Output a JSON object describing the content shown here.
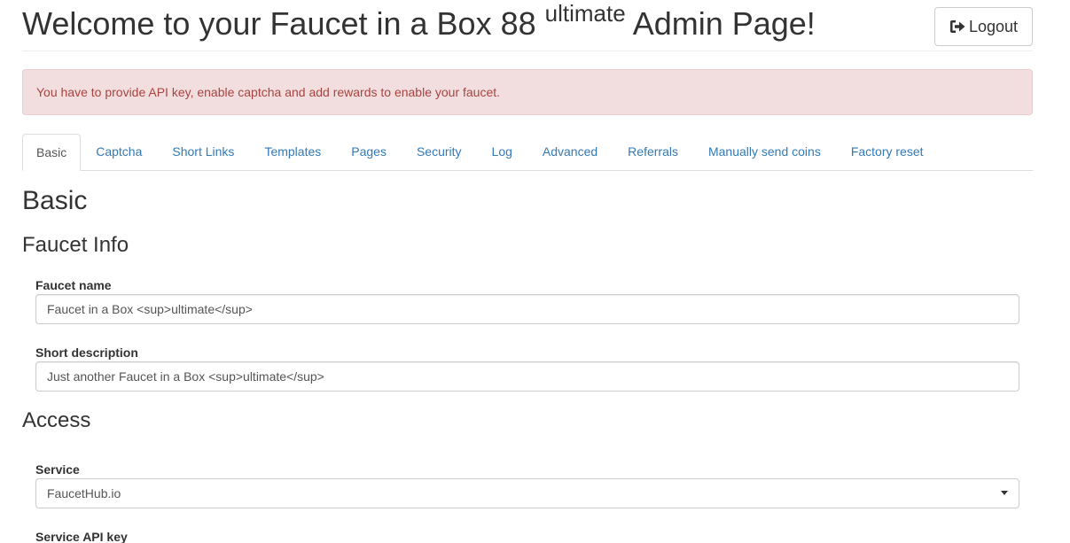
{
  "header": {
    "title_before": "Welcome to your Faucet in a Box 88 ",
    "title_sup": "ultimate",
    "title_after": " Admin Page!",
    "logout_label": "Logout"
  },
  "alert": {
    "text": "You have to provide API key, enable captcha and add rewards to enable your faucet."
  },
  "tabs": [
    {
      "label": "Basic",
      "active": true
    },
    {
      "label": "Captcha"
    },
    {
      "label": "Short Links"
    },
    {
      "label": "Templates"
    },
    {
      "label": "Pages"
    },
    {
      "label": "Security"
    },
    {
      "label": "Log"
    },
    {
      "label": "Advanced"
    },
    {
      "label": "Referrals"
    },
    {
      "label": "Manually send coins"
    },
    {
      "label": "Factory reset"
    }
  ],
  "main": {
    "heading": "Basic",
    "faucet_info": {
      "heading": "Faucet Info",
      "faucet_name_label": "Faucet name",
      "faucet_name_value": "Faucet in a Box <sup>ultimate</sup>",
      "short_description_label": "Short description",
      "short_description_value": "Just another Faucet in a Box <sup>ultimate</sup>"
    },
    "access": {
      "heading": "Access",
      "service_label": "Service",
      "service_value": "FaucetHub.io",
      "service_api_key_label": "Service API key"
    }
  },
  "colors": {
    "link": "#337ab7",
    "alert_bg": "#f2dede",
    "alert_text": "#a94442"
  },
  "icons": {
    "logout": "sign-out-icon",
    "select": "caret-down-icon"
  }
}
